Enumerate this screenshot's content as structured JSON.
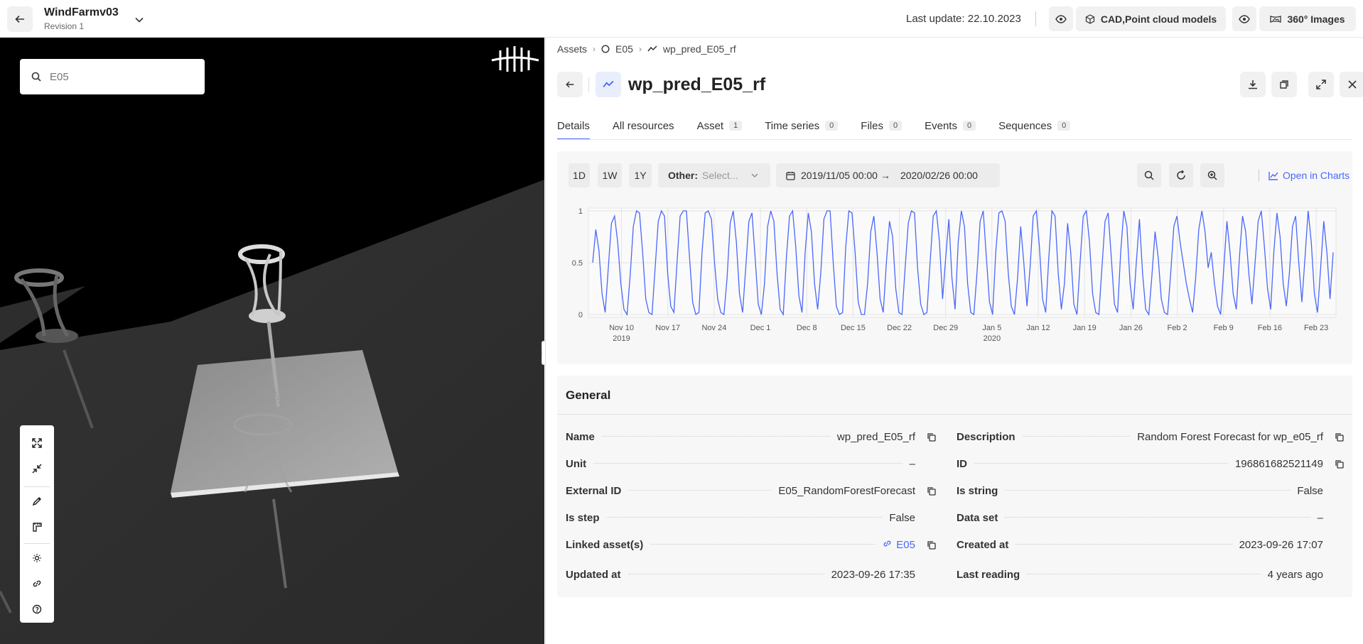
{
  "topbar": {
    "title": "WindFarmv03",
    "subtitle": "Revision 1",
    "last_update": "Last update: 22.10.2023",
    "cad_label": "CAD,Point cloud models",
    "images_label": "360° Images"
  },
  "viewer": {
    "search_placeholder": "E05"
  },
  "breadcrumb": {
    "root": "Assets",
    "asset": "E05",
    "timeseries": "wp_pred_E05_rf"
  },
  "header": {
    "title": "wp_pred_E05_rf"
  },
  "tabs": [
    {
      "label": "Details",
      "count": ""
    },
    {
      "label": "All resources",
      "count": ""
    },
    {
      "label": "Asset",
      "count": "1"
    },
    {
      "label": "Time series",
      "count": "0"
    },
    {
      "label": "Files",
      "count": "0"
    },
    {
      "label": "Events",
      "count": "0"
    },
    {
      "label": "Sequences",
      "count": "0"
    }
  ],
  "chart_controls": {
    "range_1d": "1D",
    "range_1w": "1W",
    "range_1y": "1Y",
    "other_label": "Other:",
    "other_placeholder": "Select...",
    "date_start": "2019/11/05 00:00",
    "date_end": "2020/02/26 00:00",
    "open_in_charts": "Open in Charts"
  },
  "chart_data": {
    "type": "line",
    "title": "",
    "xlabel": "",
    "ylabel": "",
    "ylim": [
      0,
      1
    ],
    "yticks": [
      "0",
      "0.5",
      "1"
    ],
    "xticks": [
      {
        "label": "Nov 10",
        "sub": "2019"
      },
      {
        "label": "Nov 17",
        "sub": ""
      },
      {
        "label": "Nov 24",
        "sub": ""
      },
      {
        "label": "Dec 1",
        "sub": ""
      },
      {
        "label": "Dec 8",
        "sub": ""
      },
      {
        "label": "Dec 15",
        "sub": ""
      },
      {
        "label": "Dec 22",
        "sub": ""
      },
      {
        "label": "Dec 29",
        "sub": ""
      },
      {
        "label": "Jan 5",
        "sub": "2020"
      },
      {
        "label": "Jan 12",
        "sub": ""
      },
      {
        "label": "Jan 19",
        "sub": ""
      },
      {
        "label": "Jan 26",
        "sub": ""
      },
      {
        "label": "Feb 2",
        "sub": ""
      },
      {
        "label": "Feb 9",
        "sub": ""
      },
      {
        "label": "Feb 16",
        "sub": ""
      },
      {
        "label": "Feb 23",
        "sub": ""
      }
    ],
    "grid": true,
    "line_color": "#4a67fb",
    "x_start": "2019-11-05",
    "x_end": "2020-02-26",
    "values": [
      0.5,
      0.82,
      0.62,
      0.2,
      0.02,
      0.45,
      0.88,
      0.95,
      0.7,
      0.3,
      0.05,
      0.0,
      0.38,
      0.85,
      1.0,
      0.98,
      0.6,
      0.15,
      0.02,
      0.0,
      0.45,
      0.9,
      1.0,
      0.95,
      0.4,
      0.08,
      0.02,
      0.5,
      0.95,
      1.0,
      1.0,
      0.55,
      0.12,
      0.0,
      0.02,
      0.6,
      0.98,
      1.0,
      0.92,
      0.5,
      0.15,
      0.02,
      0.0,
      0.35,
      0.88,
      1.0,
      0.7,
      0.2,
      0.02,
      0.45,
      0.9,
      0.98,
      0.55,
      0.1,
      0.0,
      0.3,
      0.85,
      1.0,
      0.9,
      0.4,
      0.05,
      0.0,
      0.55,
      0.95,
      1.0,
      0.65,
      0.18,
      0.02,
      0.6,
      0.98,
      0.8,
      0.3,
      0.05,
      0.4,
      0.92,
      1.0,
      1.0,
      0.5,
      0.08,
      0.0,
      0.02,
      0.65,
      1.0,
      0.98,
      0.6,
      0.12,
      0.0,
      0.0,
      0.3,
      0.8,
      0.95,
      0.6,
      0.15,
      0.02,
      0.5,
      0.9,
      0.75,
      0.25,
      0.02,
      0.0,
      0.45,
      0.88,
      1.0,
      0.98,
      0.45,
      0.1,
      0.0,
      0.02,
      0.5,
      0.95,
      1.0,
      0.7,
      0.15,
      0.55,
      0.92,
      0.35,
      0.05,
      0.7,
      1.0,
      0.85,
      0.3,
      0.02,
      0.0,
      0.4,
      0.9,
      1.0,
      0.55,
      0.12,
      0.0,
      0.6,
      0.98,
      1.0,
      0.9,
      0.4,
      0.08,
      0.0,
      0.35,
      0.85,
      0.5,
      0.08,
      0.45,
      0.95,
      1.0,
      0.65,
      0.15,
      0.02,
      0.55,
      1.0,
      0.95,
      0.4,
      0.05,
      0.3,
      0.88,
      0.6,
      0.1,
      0.0,
      0.5,
      0.95,
      1.0,
      0.7,
      0.2,
      0.02,
      0.0,
      0.45,
      0.9,
      0.98,
      0.55,
      0.1,
      0.02,
      0.6,
      1.0,
      0.85,
      0.3,
      0.05,
      0.5,
      0.92,
      0.4,
      0.05,
      0.0,
      0.38,
      0.8,
      0.55,
      0.15,
      0.02,
      0.0,
      0.4,
      0.85,
      0.95,
      0.7,
      0.5,
      0.3,
      0.15,
      0.02,
      0.35,
      0.82,
      1.0,
      0.8,
      0.45,
      0.6,
      0.3,
      0.08,
      0.0,
      0.45,
      0.9,
      0.6,
      0.2,
      0.05,
      0.55,
      0.95,
      0.8,
      0.4,
      0.1,
      0.5,
      0.9,
      1.0,
      0.65,
      0.25,
      0.05,
      0.6,
      0.98,
      0.75,
      0.3,
      0.08,
      0.4,
      0.85,
      0.95,
      0.5,
      0.12,
      0.55,
      1.0,
      0.7,
      0.2,
      0.02,
      0.45,
      0.9,
      0.6,
      0.15,
      0.6
    ]
  },
  "general": {
    "title": "General",
    "left": [
      {
        "key": "Name",
        "value": "wp_pred_E05_rf",
        "copy": true
      },
      {
        "key": "Unit",
        "value": "–",
        "copy": false
      },
      {
        "key": "External ID",
        "value": "E05_RandomForestForecast",
        "copy": true
      },
      {
        "key": "Is step",
        "value": "False",
        "copy": false
      },
      {
        "key": "Linked asset(s)",
        "value": "E05",
        "copy": true,
        "link": true
      },
      {
        "key": "Updated at",
        "value": "2023-09-26 17:35",
        "copy": false
      }
    ],
    "right": [
      {
        "key": "Description",
        "value": "Random Forest Forecast for wp_e05_rf",
        "copy": true
      },
      {
        "key": "ID",
        "value": "196861682521149",
        "copy": true
      },
      {
        "key": "Is string",
        "value": "False",
        "copy": false
      },
      {
        "key": "Data set",
        "value": "–",
        "copy": false
      },
      {
        "key": "Created at",
        "value": "2023-09-26 17:07",
        "copy": false
      },
      {
        "key": "Last reading",
        "value": "4 years ago",
        "copy": false
      }
    ]
  },
  "colors": {
    "accent": "#4a67fb",
    "viewer_bg": "#000000",
    "button_bg": "#f1f1f1"
  }
}
